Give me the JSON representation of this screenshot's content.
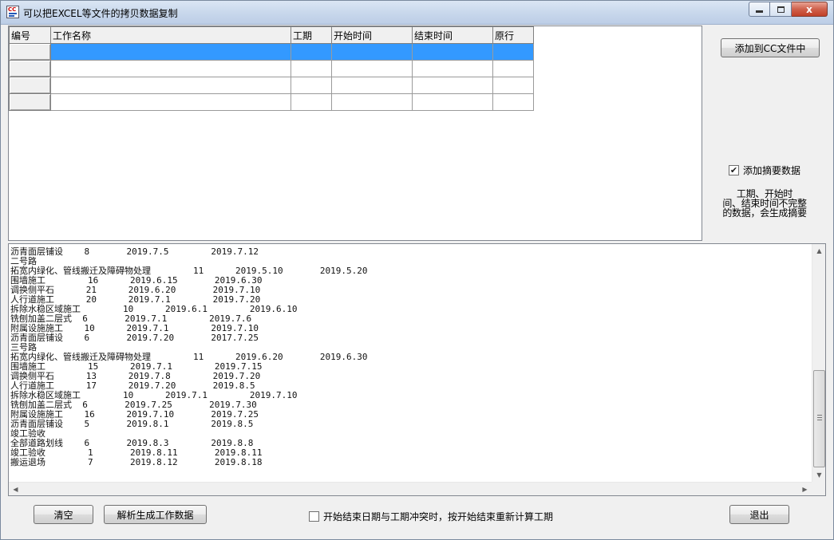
{
  "window": {
    "title": "可以把EXCEL等文件的拷贝数据复制",
    "icon": "app-icon",
    "close_glyph": "x"
  },
  "grid": {
    "columns": [
      "编号",
      "工作名称",
      "工期",
      "开始时间",
      "结束时间",
      "原行"
    ],
    "row_count": 4,
    "selected_row": 0
  },
  "side": {
    "add_button_label": "添加到CC文件中",
    "summary_check": {
      "label": "添加摘要数据",
      "checked": true,
      "mark": "✔"
    },
    "note_lines": [
      "工期、开始时",
      "间、结束时间不完整",
      "的数据，会生成摘要"
    ]
  },
  "text_area": {
    "lines": [
      "沥青面层铺设    8       2019.7.5        2019.7.12",
      "二号路",
      "拓宽内绿化、管线搬迁及障碍物处理        11      2019.5.10       2019.5.20",
      "围墙施工        16      2019.6.15       2019.6.30",
      "调换侧平石      21      2019.6.20       2019.7.10",
      "人行道施工      20      2019.7.1        2019.7.20",
      "拆除水稳区域施工        10      2019.6.1        2019.6.10",
      "铣刨加盖二层式  6       2019.7.1        2019.7.6",
      "附属设施施工    10      2019.7.1        2019.7.10",
      "沥青面层铺设    6       2019.7.20       2017.7.25",
      "三号路",
      "拓宽内绿化、管线搬迁及障碍物处理        11      2019.6.20       2019.6.30",
      "围墙施工        15      2019.7.1        2019.7.15",
      "调换侧平石      13      2019.7.8        2019.7.20",
      "人行道施工      17      2019.7.20       2019.8.5",
      "拆除水稳区域施工        10      2019.7.1        2019.7.10",
      "铣刨加盖二层式  6       2019.7.25       2019.7.30",
      "附属设施施工    16      2019.7.10       2019.7.25",
      "沥青面层铺设    5       2019.8.1        2019.8.5",
      "竣工验收",
      "全部道路划线    6       2019.8.3        2019.8.8",
      "竣工验收        1       2019.8.11       2019.8.11",
      "搬运退场        7       2019.8.12       2019.8.18"
    ],
    "scroll_up": "▲",
    "scroll_down": "▼",
    "scroll_left": "◀",
    "scroll_right": "▶"
  },
  "bottom": {
    "clear_label": "清空",
    "parse_label": "解析生成工作数据",
    "recalc_check": {
      "label": "开始结束日期与工期冲突时，按开始结束重新计算工期",
      "checked": false
    },
    "exit_label": "退出"
  }
}
